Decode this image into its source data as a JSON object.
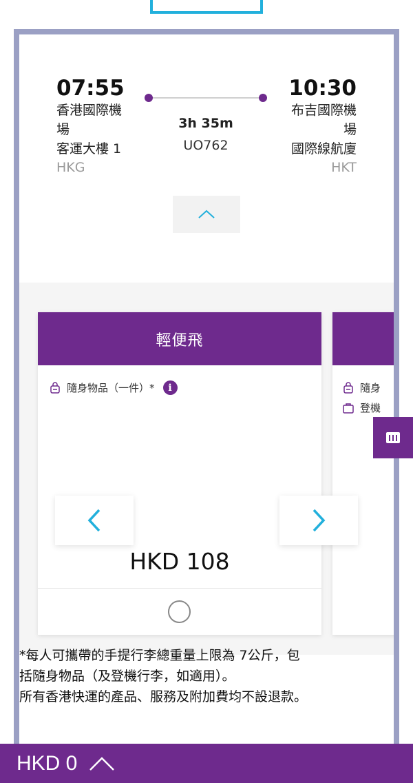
{
  "flight": {
    "departure": {
      "time": "07:55",
      "airport_line1": "香港國際機",
      "airport_line2": "場",
      "terminal": "客運大樓 1",
      "code": "HKG"
    },
    "arrival": {
      "time": "10:30",
      "airport_line1": "布吉國際機",
      "airport_line2": "場",
      "terminal": "國際線航廈",
      "code": "HKT"
    },
    "duration": "3h 35m",
    "flight_number": "UO762"
  },
  "fares": [
    {
      "name": "輕便飛",
      "benefits": [
        {
          "label": "隨身物品（一件）*",
          "icon": "backpack-icon"
        }
      ],
      "price": "HKD 108",
      "selected": false
    },
    {
      "name": "",
      "benefits": [
        {
          "label": "隨身",
          "icon": "backpack-icon"
        },
        {
          "label": "登機",
          "icon": "suitcase-icon"
        }
      ]
    }
  ],
  "note": {
    "line1": "*每人可攜帶的手提行李總重量上限為 7公斤，包",
    "line2": "括隨身物品（及登機行李，如適用）。",
    "line3": "所有香港快運的產品、服務及附加費均不設退款。"
  },
  "bottom_bar": {
    "total": "HKD 0"
  },
  "colors": {
    "brand_purple": "#6e2a8d",
    "accent_cyan": "#22b0dc",
    "frame": "#9ba0c4"
  }
}
